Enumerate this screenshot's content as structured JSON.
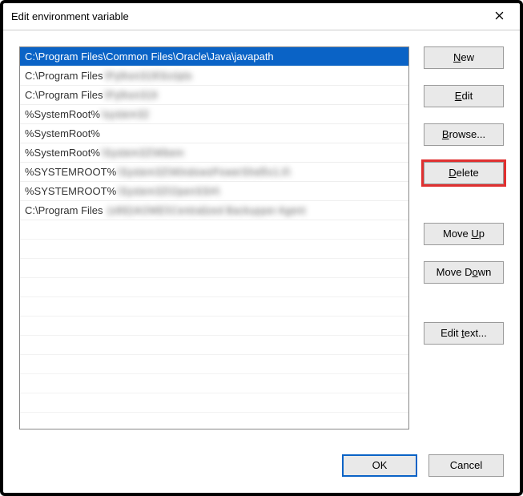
{
  "window": {
    "title": "Edit environment variable"
  },
  "list": {
    "selected_index": 0,
    "rows": [
      {
        "visible": "C:\\Program Files\\Common Files\\Oracle\\Java\\javapath",
        "obscured": ""
      },
      {
        "visible": "C:\\Program Files",
        "obscured": "\\Python319\\Scripts"
      },
      {
        "visible": "C:\\Program Files",
        "obscured": "\\Python319"
      },
      {
        "visible": "%SystemRoot%",
        "obscured": "\\system32"
      },
      {
        "visible": "%SystemRoot%",
        "obscured": ""
      },
      {
        "visible": "%SystemRoot%",
        "obscured": "\\System32\\Wbem"
      },
      {
        "visible": "%SYSTEMROOT%",
        "obscured": "\\System32\\WindowsPowerShell\\v1.0\\"
      },
      {
        "visible": "%SYSTEMROOT%",
        "obscured": "\\System32\\OpenSSH\\"
      },
      {
        "visible": "C:\\Program Files",
        "obscured": " (x86)\\AOMEI\\Centralized Backupper Agent"
      }
    ],
    "empty_rows": 10
  },
  "buttons": {
    "new": {
      "pre": "",
      "hot": "N",
      "post": "ew"
    },
    "edit": {
      "pre": "",
      "hot": "E",
      "post": "dit"
    },
    "browse": {
      "pre": "",
      "hot": "B",
      "post": "rowse..."
    },
    "delete": {
      "pre": "",
      "hot": "D",
      "post": "elete"
    },
    "moveup": {
      "pre": "Move ",
      "hot": "U",
      "post": "p"
    },
    "movedown": {
      "pre": "Move D",
      "hot": "o",
      "post": "wn"
    },
    "edittext": {
      "pre": "Edit ",
      "hot": "t",
      "post": "ext..."
    }
  },
  "footer": {
    "ok": "OK",
    "cancel": "Cancel"
  }
}
